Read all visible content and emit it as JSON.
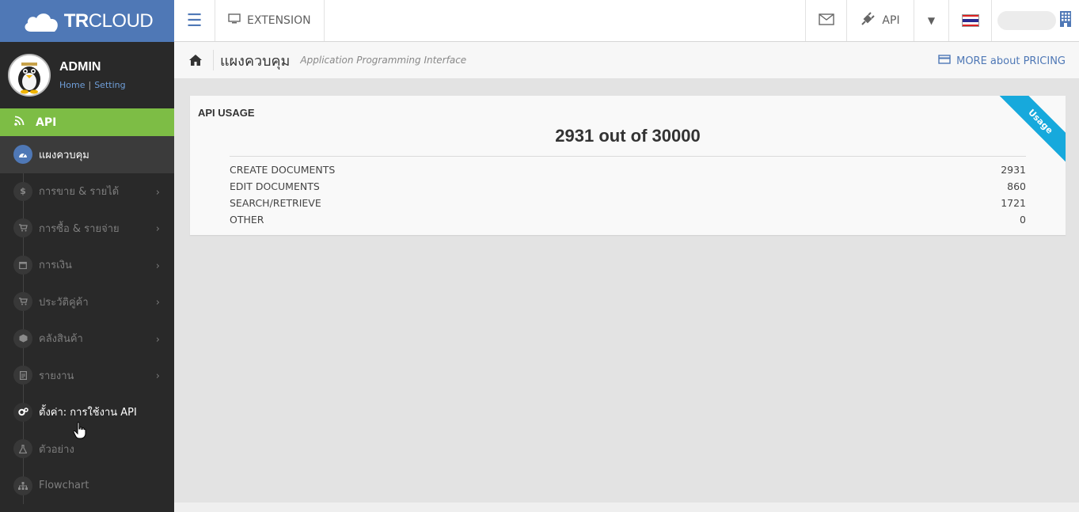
{
  "brand": {
    "bold": "TR",
    "rest": "CLOUD"
  },
  "topbar": {
    "extension_label": "EXTENSION",
    "api_label": "API"
  },
  "profile": {
    "name": "ADMIN",
    "link_home": "Home",
    "link_setting": "Setting",
    "separator": "|"
  },
  "sidebar": {
    "section_label": "API",
    "items": [
      {
        "label": "แผงควบคุม",
        "icon": "dashboard-icon",
        "state": "active",
        "chevron": false
      },
      {
        "label": "การขาย & รายได้",
        "icon": "dollar-icon",
        "state": "normal",
        "chevron": true
      },
      {
        "label": "การซื้อ & รายจ่าย",
        "icon": "cart-icon",
        "state": "normal",
        "chevron": true
      },
      {
        "label": "การเงิน",
        "icon": "calendar-icon",
        "state": "normal",
        "chevron": true
      },
      {
        "label": "ประวัติคู่ค้า",
        "icon": "cart-icon",
        "state": "normal",
        "chevron": true
      },
      {
        "label": "คลังสินค้า",
        "icon": "box-icon",
        "state": "normal",
        "chevron": true
      },
      {
        "label": "รายงาน",
        "icon": "report-icon",
        "state": "normal",
        "chevron": true
      },
      {
        "label": "ตั้งค่า: การใช้งาน API",
        "icon": "gears-icon",
        "state": "highlight",
        "chevron": false
      },
      {
        "label": "ตัวอย่าง",
        "icon": "flask-icon",
        "state": "normal",
        "chevron": false
      },
      {
        "label": "Flowchart",
        "icon": "sitemap-icon",
        "state": "normal",
        "chevron": false
      }
    ]
  },
  "breadcrumb": {
    "title": "แผงควบคุม",
    "subtitle": "Application Programming Interface",
    "pricing_link": "MORE about PRICING"
  },
  "usage": {
    "title": "API USAGE",
    "summary": "2931 out of 30000",
    "ribbon": "Usage",
    "rows": [
      {
        "label": "CREATE DOCUMENTS",
        "value": "2931"
      },
      {
        "label": "EDIT DOCUMENTS",
        "value": "860"
      },
      {
        "label": "SEARCH/RETRIEVE",
        "value": "1721"
      },
      {
        "label": "OTHER",
        "value": "0"
      }
    ]
  },
  "colors": {
    "brand_blue": "#4f78b6",
    "api_green": "#7dbd45",
    "ribbon_cyan": "#17a9dc",
    "sidebar_bg": "#292929"
  }
}
